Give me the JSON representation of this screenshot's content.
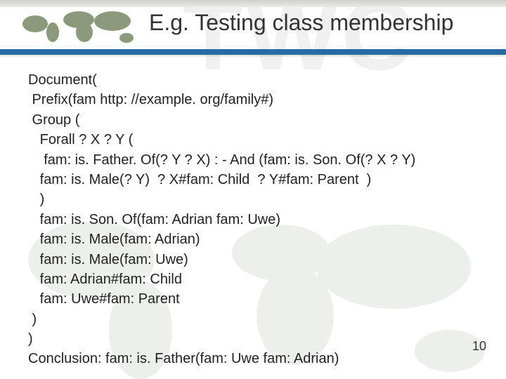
{
  "watermark": "TWC",
  "header": {
    "title": "E.g. Testing class membership"
  },
  "code": {
    "lines": [
      "Document(",
      " Prefix(fam http: //example. org/family#)",
      " Group (",
      "   Forall ? X ? Y (",
      "    fam: is. Father. Of(? Y ? X) : - And (fam: is. Son. Of(? X ? Y)",
      "   fam: is. Male(? Y)  ? X#fam: Child  ? Y#fam: Parent  )",
      "   )",
      "   fam: is. Son. Of(fam: Adrian fam: Uwe)",
      "   fam: is. Male(fam: Adrian)",
      "   fam: is. Male(fam: Uwe)",
      "   fam: Adrian#fam: Child",
      "   fam: Uwe#fam: Parent",
      " )",
      ")",
      "Conclusion: fam: is. Father(fam: Uwe fam: Adrian)"
    ]
  },
  "page_number": "10"
}
